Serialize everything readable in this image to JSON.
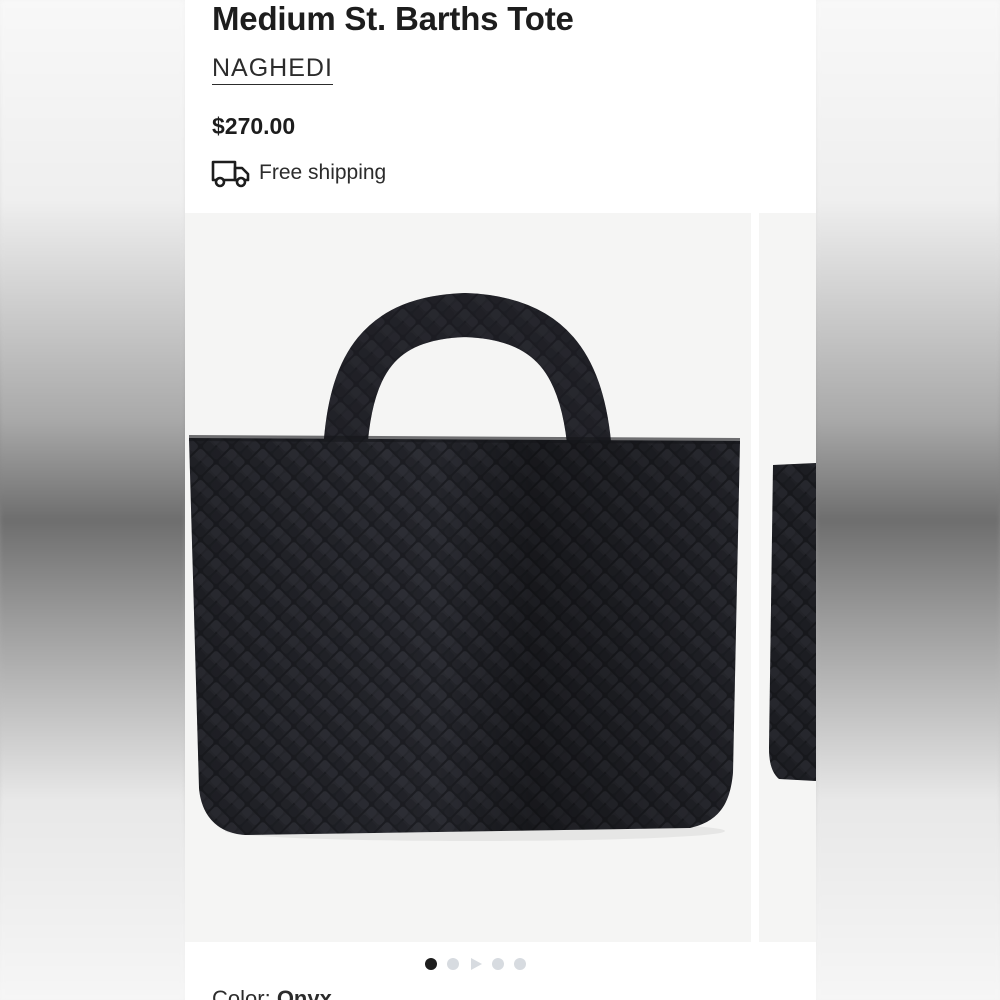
{
  "product": {
    "title": "Medium St. Barths Tote",
    "brand": "NAGHEDI",
    "price": "$270.00",
    "shipping": "Free shipping",
    "color_label": "Color:",
    "color_value": "Onyx"
  },
  "gallery": {
    "total_slides": 5,
    "active_index": 0,
    "dot_types": [
      "image",
      "image",
      "video",
      "image",
      "image"
    ]
  },
  "colors": {
    "text": "#1d1d1d",
    "bag": "#1c1d22",
    "dot_active": "#1d1d1d",
    "dot_inactive": "#d7dbe0",
    "image_bg": "#f5f5f4"
  },
  "icons": {
    "shipping": "truck-icon"
  }
}
